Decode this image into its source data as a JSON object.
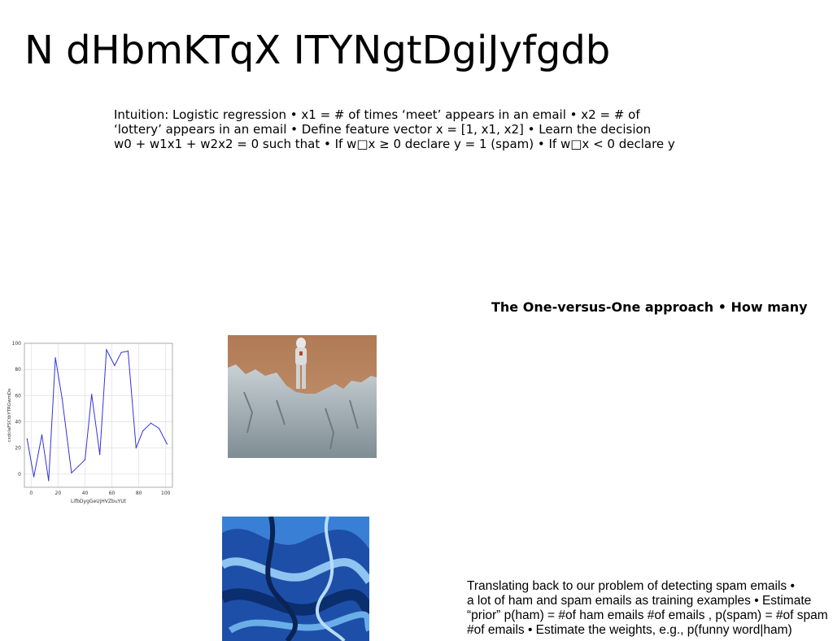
{
  "slide": {
    "title": "N dHbmKTqX ITYNgtDgiJyfgdb",
    "paragraph1": {
      "lines": [
        "Intuition: Logistic regression • x1 = # of times ‘meet’ appears in an email • x2 = # of",
        "‘lottery’ appears in an email • Define feature vector x = [1, x1, x2] • Learn the decision",
        "w0 + w1x1 + w2x2 = 0 such that • If w□x ≥ 0 declare y = 1 (spam) • If w□x < 0 declare y"
      ]
    },
    "heading2": "The One-versus-One approach • How many",
    "paragraph2": {
      "lines": [
        "Translating back to our problem of detecting spam emails •",
        "a lot of ham and spam emails as training examples • Estimate",
        "“prior” p(ham) = #of ham emails #of emails , p(spam) = #of spam",
        "#of emails • Estimate the weights, e.g., p(funny word|ham)"
      ]
    },
    "images": {
      "photo1": "astronaut-on-cliff-photo",
      "photo2": "blue-abstract-texture-photo"
    }
  },
  "chart_data": {
    "type": "line",
    "xlabel": "LifbDygGeUjHVZbuYUt",
    "ylabel": "cxdcIaFSCtbYTRGwmDe",
    "xlim": [
      -5,
      105
    ],
    "ylim": [
      -10,
      100
    ],
    "xticks": [
      0,
      20,
      40,
      60,
      80,
      100
    ],
    "yticks": [
      0,
      20,
      40,
      60,
      80,
      100
    ],
    "grid": true,
    "line_color": "#3333dd",
    "x": [
      -3,
      2,
      8,
      13,
      18,
      23,
      30,
      35,
      40,
      45,
      51,
      56,
      62,
      67,
      72,
      78,
      83,
      89,
      95,
      101
    ],
    "y": [
      27,
      -2,
      30,
      -5,
      89,
      58,
      1,
      6,
      11,
      61,
      15,
      95,
      83,
      93,
      94,
      20,
      33,
      39,
      35,
      23
    ]
  }
}
